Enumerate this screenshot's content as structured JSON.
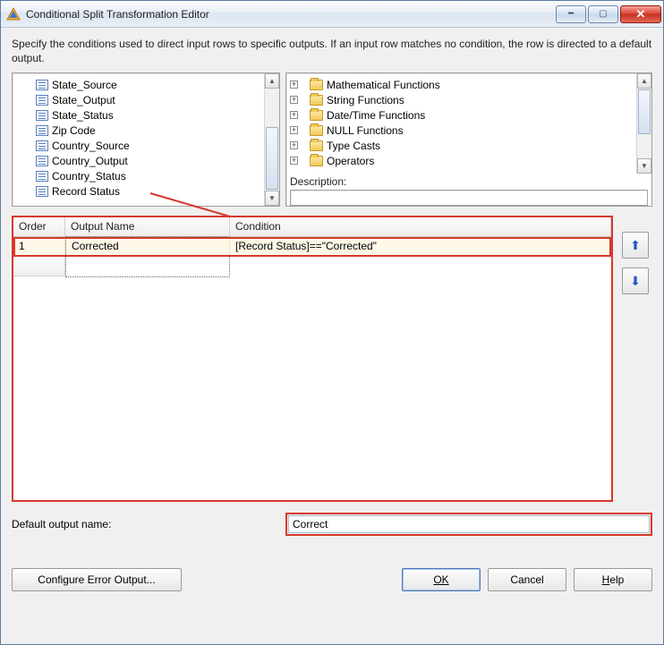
{
  "window": {
    "title": "Conditional Split Transformation Editor",
    "instruction": "Specify the conditions used to direct input rows to specific outputs. If an input row matches no condition, the row is directed to a default output."
  },
  "columns": [
    "State_Source",
    "State_Output",
    "State_Status",
    "Zip Code",
    "Country_Source",
    "Country_Output",
    "Country_Status",
    "Record Status"
  ],
  "functions": [
    "Mathematical Functions",
    "String Functions",
    "Date/Time Functions",
    "NULL Functions",
    "Type Casts",
    "Operators"
  ],
  "description_label": "Description:",
  "grid": {
    "headers": {
      "order": "Order",
      "output_name": "Output Name",
      "condition": "Condition"
    },
    "rows": [
      {
        "order": "1",
        "output_name": "Corrected",
        "condition": "[Record Status]==\"Corrected\""
      }
    ]
  },
  "default_output": {
    "label": "Default output name:",
    "value": "Correct"
  },
  "buttons": {
    "configure_error": "Configure Error Output...",
    "ok": "OK",
    "cancel": "Cancel",
    "help": "Help"
  }
}
